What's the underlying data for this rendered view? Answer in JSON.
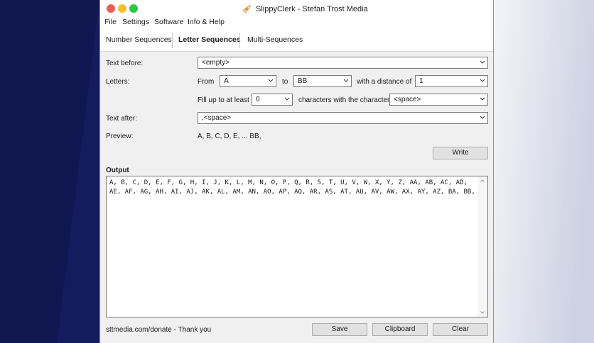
{
  "window": {
    "title": "SlippyClerk - Stefan Trost Media"
  },
  "menu": [
    "File",
    "Settings",
    "Software",
    "Info & Help"
  ],
  "tabs": [
    {
      "label": "Number Sequences",
      "active": false
    },
    {
      "label": "Letter Sequences",
      "active": true
    },
    {
      "label": "Multi-Sequences",
      "active": false
    }
  ],
  "form": {
    "text_before_label": "Text before:",
    "text_before_value": "<empty>",
    "letters_label": "Letters:",
    "from_label": "From",
    "from_value": "A",
    "to_label": "to",
    "to_value": "BB",
    "distance_label": "with a distance of",
    "distance_value": "1",
    "fill_label": "Fill up to at least",
    "fill_value": "0",
    "char_label": "characters with the character",
    "char_value": "<space>",
    "text_after_label": "Text after:",
    "text_after_value": ",<space>",
    "preview_label": "Preview:",
    "preview_value": "A, B, C, D, E, ... BB,",
    "write_button": "Write"
  },
  "output": {
    "label": "Output",
    "text": "A, B, C, D, E, F, G, H, I, J, K, L, M, N, O, P, Q, R, S, T, U, V, W, X, Y, Z, AA, AB, AC, AD, AE, AF, AG, AH, AI, AJ, AK, AL, AM, AN, AO, AP, AQ, AR, AS, AT, AU, AV, AW, AX, AY, AZ, BA, BB,"
  },
  "footer": {
    "donate_text": "sttmedia.com/donate - Thank you",
    "save_button": "Save",
    "clipboard_button": "Clipboard",
    "clear_button": "Clear"
  },
  "colors": {
    "bg_dark": "#141c5e",
    "bg_light": "#dfe2ee",
    "window_bg": "#f0f0f0"
  }
}
